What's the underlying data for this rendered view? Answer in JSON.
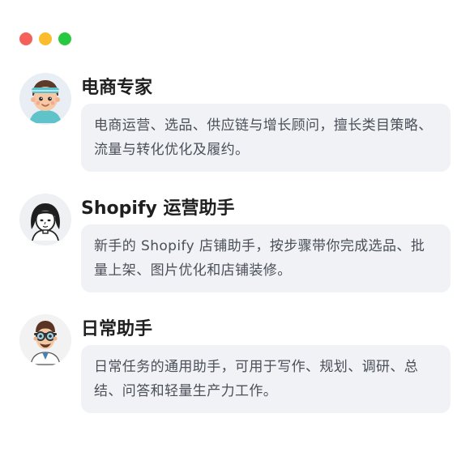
{
  "window": {
    "controls": {
      "close_color": "#f4615a",
      "minimize_color": "#fbbd2e",
      "maximize_color": "#2ac840"
    }
  },
  "agents": [
    {
      "name": "电商专家",
      "description": "电商运营、选品、供应链与增长顾问，擅长类目策略、流量与转化优化及履约。",
      "avatar_icon": "cartoon-boy-headband-avatar"
    },
    {
      "name": "Shopify 运营助手",
      "description": "新手的 Shopify 店铺助手，按步骤带你完成选品、批量上架、图片优化和店铺装修。",
      "avatar_icon": "line-art-woman-avatar"
    },
    {
      "name": "日常助手",
      "description": "日常任务的通用助手，可用于写作、规划、调研、总结、问答和轻量生产力工作。",
      "avatar_icon": "cartoon-man-goggles-avatar"
    }
  ]
}
